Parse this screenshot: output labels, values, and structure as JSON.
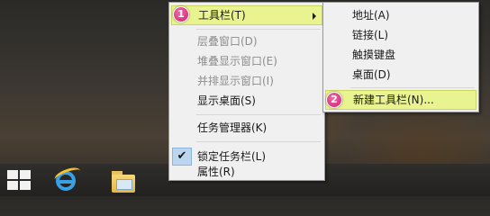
{
  "context_menu": {
    "items": [
      {
        "label": "工具栏(T)",
        "state": "highlighted",
        "has_submenu": true,
        "step_badge": "1"
      },
      {
        "label": "层叠窗口(D)",
        "state": "disabled"
      },
      {
        "label": "堆叠显示窗口(E)",
        "state": "disabled"
      },
      {
        "label": "并排显示窗口(I)",
        "state": "disabled"
      },
      {
        "label": "显示桌面(S)",
        "state": "enabled"
      },
      {
        "label": "任务管理器(K)",
        "state": "enabled"
      },
      {
        "label": "锁定任务栏(L)",
        "state": "checked",
        "check_icon": "checkmark-icon",
        "check_glyph": "✔"
      },
      {
        "label": "属性(R)",
        "state": "enabled"
      }
    ]
  },
  "toolbars_submenu": {
    "items": [
      {
        "label": "地址(A)"
      },
      {
        "label": "链接(L)"
      },
      {
        "label": "触摸键盘"
      },
      {
        "label": "桌面(D)"
      },
      {
        "label": "新建工具栏(N)...",
        "state": "highlighted",
        "step_badge": "2"
      }
    ]
  },
  "taskbar": {
    "icons": [
      "windows-start-icon",
      "internet-explorer-icon",
      "file-explorer-icon"
    ]
  },
  "colors": {
    "highlight": "#e9f38f",
    "badge": "#d21f74",
    "menu_background": "#f0f0f0",
    "disabled_text": "#8d8d8d"
  }
}
